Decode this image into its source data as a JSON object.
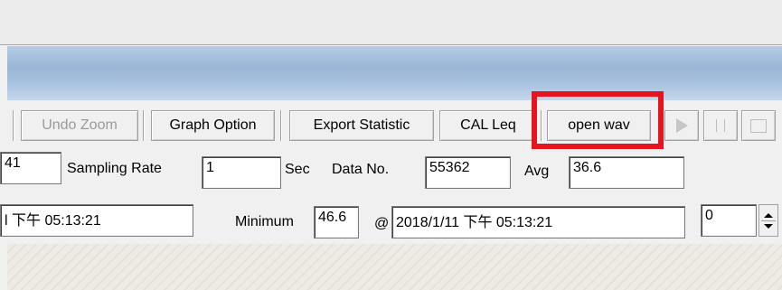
{
  "toolbar": {
    "undo_zoom": "Undo Zoom",
    "graph_option": "Graph Option",
    "export_statistic": "Export Statistic",
    "cal_leq": "CAL Leq",
    "open_wav": "open wav",
    "play_icon": "play-icon",
    "pause_icon": "pause-icon",
    "stop_icon": "stop-icon"
  },
  "row1": {
    "partial_value": "41",
    "sampling_rate_label": "Sampling Rate",
    "sampling_rate_value": "1",
    "sec_label": "Sec",
    "data_no_label": "Data No.",
    "data_no_value": "55362",
    "avg_label": "Avg",
    "avg_value": "36.6"
  },
  "row2": {
    "partial_time": "l 下午 05:13:21",
    "minimum_label": "Minimum",
    "minimum_value": "46.6",
    "at_label": "@",
    "minimum_time": "2018/1/11 下午 05:13:21",
    "spin_value": "0"
  },
  "colors": {
    "highlight": "#e5141e",
    "band": "#a9c2df"
  }
}
